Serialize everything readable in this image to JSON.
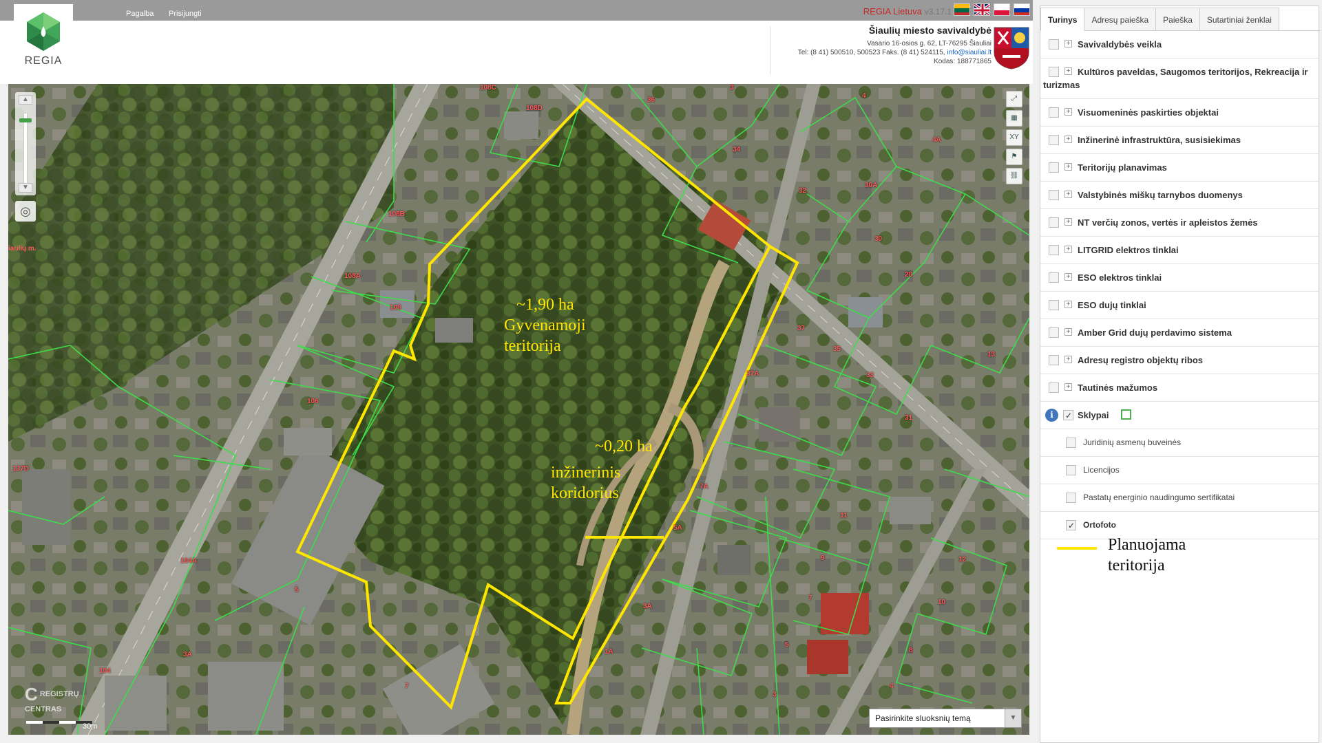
{
  "header": {
    "logo_text": "REGIA",
    "links": [
      "Pagalba",
      "Prisijungti"
    ],
    "app_name": "REGIA Lietuva",
    "app_version": "v3.17.1",
    "flags": [
      "lithuanian-flag",
      "english-flag",
      "polish-flag",
      "russian-flag"
    ]
  },
  "municipality": {
    "title": "Šiaulių miesto savivaldybė",
    "address": "Vasario 16-osios g. 62, LT-76295 Šiauliai",
    "contacts_prefix": "Tel: (8 41) 500510, 500523 Faks. (8 41) 524115,",
    "email": "info@siauliai.lt",
    "code": "Kodas: 188771865"
  },
  "map": {
    "parcel_labels": [
      {
        "t": "108C"
      },
      {
        "t": "108D"
      },
      {
        "t": "3"
      },
      {
        "t": "36"
      },
      {
        "t": "34"
      },
      {
        "t": "4"
      },
      {
        "t": "4A"
      },
      {
        "t": "32"
      },
      {
        "t": "30A"
      },
      {
        "t": "30"
      },
      {
        "t": "28"
      },
      {
        "t": "108B"
      },
      {
        "t": "108A"
      },
      {
        "t": "108"
      },
      {
        "t": "37"
      },
      {
        "t": "35"
      },
      {
        "t": "33"
      },
      {
        "t": "37A"
      },
      {
        "t": "31"
      },
      {
        "t": "13"
      },
      {
        "t": "106"
      },
      {
        "t": "137D"
      },
      {
        "t": "7A"
      },
      {
        "t": "5A"
      },
      {
        "t": "11"
      },
      {
        "t": "9"
      },
      {
        "t": "7"
      },
      {
        "t": "12"
      },
      {
        "t": "10"
      },
      {
        "t": "104A"
      },
      {
        "t": "5"
      },
      {
        "t": "3A"
      },
      {
        "t": "1A"
      },
      {
        "t": "5"
      },
      {
        "t": "8"
      },
      {
        "t": "3"
      },
      {
        "t": "4"
      },
      {
        "t": "104"
      },
      {
        "t": "3A"
      },
      {
        "t": "7"
      }
    ],
    "left_edge_label": "iaulių m.",
    "annotation_main": [
      "~1,90 ha",
      "Gyvenamoji",
      "teritorija"
    ],
    "annotation_corridor": [
      "~0,20 ha",
      "inžinerinis",
      "koridorius"
    ],
    "theme_select": "Pasirinkite sluoksnių temą",
    "scale_text": "30m",
    "corner_logo": "REGISTRŲ CENTRAS",
    "colors": {
      "plan_outline": "#ffe600",
      "parcel_lines": "#3ddc4a",
      "road": "#9a9a92"
    }
  },
  "panel": {
    "tabs": [
      "Turinys",
      "Adresų paieška",
      "Paieška",
      "Sutartiniai ženklai"
    ],
    "active_tab": 0,
    "layers": [
      "Savivaldybės veikla",
      "Kultūros paveldas, Saugomos teritorijos, Rekreacija ir turizmas",
      "Visuomeninės paskirties objektai",
      "Inžinerinė infrastruktūra, susisiekimas",
      "Teritorijų planavimas",
      "Valstybinės miškų tarnybos duomenys",
      "NT verčių zonos, vertės ir apleistos žemės",
      "LITGRID elektros tinklai",
      "ESO elektros tinklai",
      "ESO dujų tinklai",
      "Amber Grid dujų perdavimo sistema",
      "Adresų registro objektų ribos",
      "Tautinės mažumos"
    ],
    "sklypai": {
      "label": "Sklypai",
      "checked": true
    },
    "sublayers": [
      {
        "label": "Juridinių asmenų buveinės",
        "checked": false
      },
      {
        "label": "Licencijos",
        "checked": false
      },
      {
        "label": "Pastatų energinio naudingumo sertifikatai",
        "checked": false
      }
    ],
    "ortofoto": {
      "label": "Ortofoto",
      "checked": true
    },
    "legend": [
      "Planuojama",
      "teritorija"
    ]
  }
}
